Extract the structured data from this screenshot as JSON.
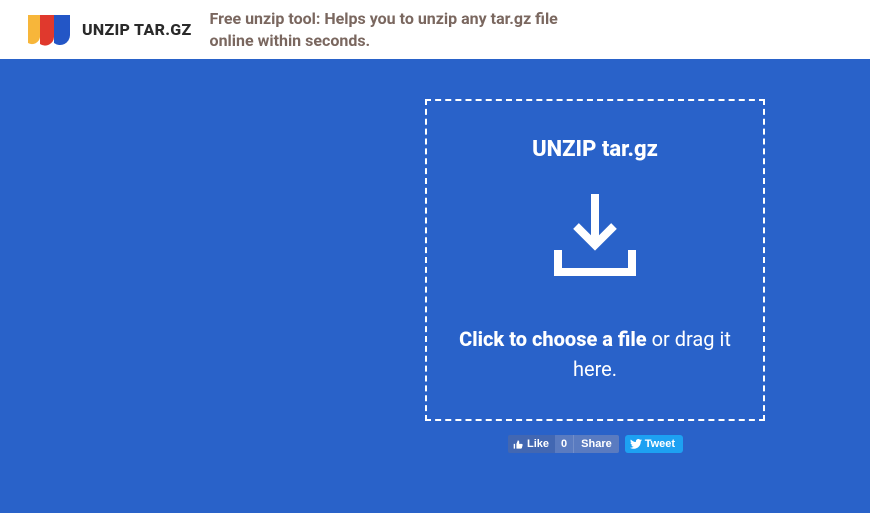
{
  "brand": {
    "name": "UNZIP TAR.GZ",
    "tagline": "Free unzip tool: Helps you to unzip any tar.gz file online within seconds."
  },
  "dropzone": {
    "title": "UNZIP tar.gz",
    "cta_bold": "Click to choose a file",
    "cta_rest": " or drag it here."
  },
  "social": {
    "fb_like": "Like",
    "fb_count": "0",
    "fb_share": "Share",
    "tw_tweet": "Tweet"
  },
  "colors": {
    "hero": "#2962c9",
    "fb": "#4267B2",
    "tw": "#1DA1F2"
  }
}
